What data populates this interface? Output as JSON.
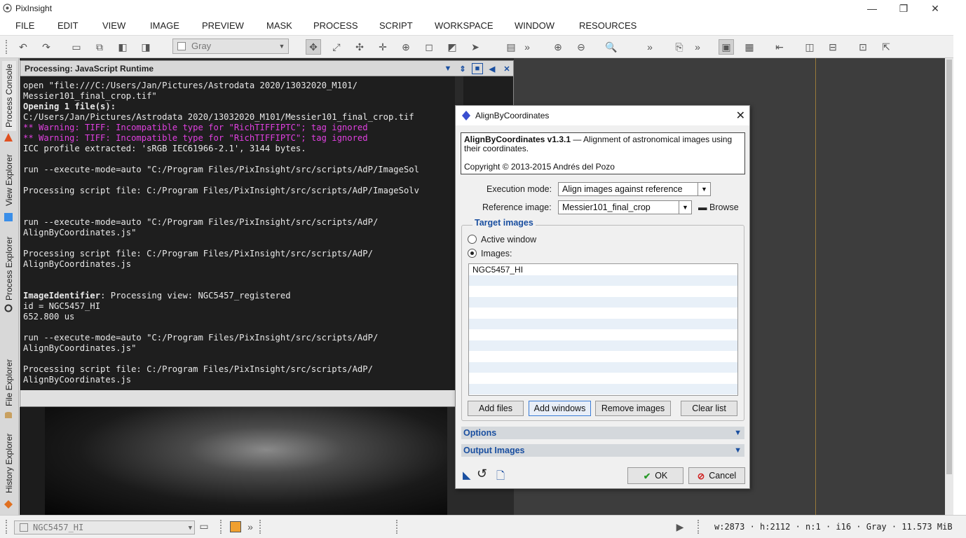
{
  "app": {
    "title": "PixInsight"
  },
  "window_controls": {
    "minimize": "—",
    "restore": "❐",
    "close": "✕"
  },
  "menu": [
    "FILE",
    "EDIT",
    "VIEW",
    "IMAGE",
    "PREVIEW",
    "MASK",
    "PROCESS",
    "SCRIPT",
    "WORKSPACE",
    "WINDOW",
    "RESOURCES"
  ],
  "toolbar": {
    "color_space": "Gray",
    "overflow": "»"
  },
  "sidebar": {
    "tabs": [
      "Process Console",
      "View Explorer",
      "Process Explorer",
      "File Explorer",
      "History Explorer"
    ]
  },
  "console": {
    "title": "Processing: JavaScript Runtime",
    "lines": [
      {
        "t": "open \"file:///C:/Users/Jan/Pictures/Astrodata 2020/13032020_M101/",
        "k": ""
      },
      {
        "t": "Messier101_final_crop.tif\"",
        "k": ""
      },
      {
        "t": "Opening 1 file(s):",
        "k": "b"
      },
      {
        "t": "C:/Users/Jan/Pictures/Astrodata 2020/13032020_M101/Messier101_final_crop.tif",
        "k": ""
      },
      {
        "t": "** Warning: TIFF: Incompatible type for \"RichTIFFIPTC\"; tag ignored",
        "k": "warn"
      },
      {
        "t": "** Warning: TIFF: Incompatible type for \"RichTIFFIPTC\"; tag ignored",
        "k": "warn"
      },
      {
        "t": "ICC profile extracted: 'sRGB IEC61966-2.1', 3144 bytes.",
        "k": ""
      },
      {
        "t": "",
        "k": ""
      },
      {
        "t": "run --execute-mode=auto \"C:/Program Files/PixInsight/src/scripts/AdP/ImageSol",
        "k": ""
      },
      {
        "t": "",
        "k": ""
      },
      {
        "t": "Processing script file: C:/Program Files/PixInsight/src/scripts/AdP/ImageSolv",
        "k": ""
      },
      {
        "t": "",
        "k": ""
      },
      {
        "t": "",
        "k": ""
      },
      {
        "t": "run --execute-mode=auto \"C:/Program Files/PixInsight/src/scripts/AdP/",
        "k": ""
      },
      {
        "t": "AlignByCoordinates.js\"",
        "k": ""
      },
      {
        "t": "",
        "k": ""
      },
      {
        "t": "Processing script file: C:/Program Files/PixInsight/src/scripts/AdP/",
        "k": ""
      },
      {
        "t": "AlignByCoordinates.js",
        "k": ""
      },
      {
        "t": "",
        "k": ""
      },
      {
        "t": "",
        "k": ""
      },
      {
        "t": "ImageIdentifier: Processing view: NGC5457_registered",
        "k": "ii"
      },
      {
        "t": "id = NGC5457_HI",
        "k": ""
      },
      {
        "t": "652.800 us",
        "k": ""
      },
      {
        "t": "",
        "k": ""
      },
      {
        "t": "run --execute-mode=auto \"C:/Program Files/PixInsight/src/scripts/AdP/",
        "k": ""
      },
      {
        "t": "AlignByCoordinates.js\"",
        "k": ""
      },
      {
        "t": "",
        "k": ""
      },
      {
        "t": "Processing script file: C:/Program Files/PixInsight/src/scripts/AdP/",
        "k": ""
      },
      {
        "t": "AlignByCoordinates.js",
        "k": ""
      }
    ]
  },
  "dialog": {
    "title": "AlignByCoordinates",
    "info_name": "AlignByCoordinates v1.3.1",
    "info_desc": " — Alignment of astronomical images using their coordinates.",
    "info_copy": "Copyright © 2013-2015 Andrés del Pozo",
    "exec_label": "Execution mode:",
    "exec_value": "Align images against reference",
    "ref_label": "Reference image:",
    "ref_value": "Messier101_final_crop",
    "browse": "Browse",
    "target_title": "Target images",
    "radio_active": "Active window",
    "radio_images": "Images:",
    "images": [
      "NGC5457_HI",
      "",
      "",
      "",
      "",
      "",
      "",
      "",
      "",
      "",
      "",
      ""
    ],
    "btn_add_files": "Add files",
    "btn_add_windows": "Add windows",
    "btn_remove": "Remove images",
    "btn_clear": "Clear list",
    "sec_options": "Options",
    "sec_output": "Output Images",
    "ok": "OK",
    "cancel": "Cancel"
  },
  "status": {
    "view": "NGC5457_HI",
    "info": "w:2873 · h:2112 · n:1 · i16 · Gray · 11.573 MiB"
  }
}
